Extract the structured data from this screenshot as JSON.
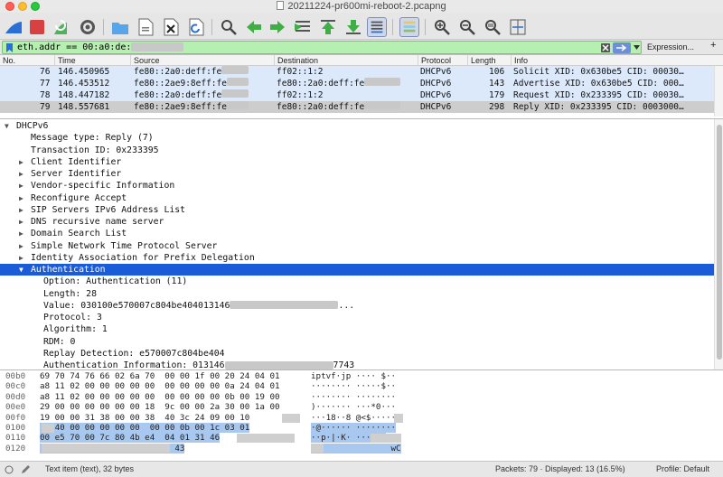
{
  "window": {
    "title": "20211224-pr600mi-reboot-2.pcapng"
  },
  "toolbar": {
    "icons": [
      "shark-fin-start-icon",
      "stop-icon",
      "restart-icon",
      "options-gear-icon",
      "open-folder-icon",
      "save-icon",
      "close-file-icon",
      "reload-icon",
      "find-icon",
      "back-icon",
      "forward-icon",
      "go-to-packet-icon",
      "first-packet-icon",
      "last-packet-icon",
      "autoscroll-icon",
      "colorize-icon",
      "zoom-in-icon",
      "zoom-out-icon",
      "normal-size-icon",
      "resize-columns-icon"
    ]
  },
  "filter": {
    "value": "eth.addr == 00:a0:de:",
    "expression_label": "Expression...",
    "plus_label": "+"
  },
  "packet_list": {
    "columns": [
      "No.",
      "Time",
      "Source",
      "Destination",
      "Protocol",
      "Length",
      "Info"
    ],
    "rows": [
      {
        "no": "76",
        "time": "146.450965",
        "source": "fe80::2a0:deff:fe",
        "destination": "ff02::1:2",
        "protocol": "DHCPv6",
        "length": "106",
        "info": "Solicit XID: 0x630be5 CID: 00030…"
      },
      {
        "no": "77",
        "time": "146.453512",
        "source": "fe80::2ae9:8eff:fe",
        "destination": "fe80::2a0:deff:fe",
        "protocol": "DHCPv6",
        "length": "143",
        "info": "Advertise XID: 0x630be5 CID: 000…"
      },
      {
        "no": "78",
        "time": "148.447182",
        "source": "fe80::2a0:deff:fe",
        "destination": "ff02::1:2",
        "protocol": "DHCPv6",
        "length": "179",
        "info": "Request XID: 0x233395 CID: 00030…"
      },
      {
        "no": "79",
        "time": "148.557681",
        "source": "fe80::2ae9:8eff:fe",
        "destination": "fe80::2a0:deff:fe",
        "protocol": "DHCPv6",
        "length": "298",
        "info": "Reply XID: 0x233395 CID: 0003000…"
      }
    ]
  },
  "details": {
    "rows": [
      {
        "text": "DHCPv6",
        "indent": 0,
        "tri": "▼"
      },
      {
        "text": "Message type: Reply (7)",
        "indent": 1,
        "tri": ""
      },
      {
        "text": "Transaction ID: 0x233395",
        "indent": 1,
        "tri": ""
      },
      {
        "text": "Client Identifier",
        "indent": 1,
        "tri": "▶"
      },
      {
        "text": "Server Identifier",
        "indent": 1,
        "tri": "▶"
      },
      {
        "text": "Vendor-specific Information",
        "indent": 1,
        "tri": "▶"
      },
      {
        "text": "Reconfigure Accept",
        "indent": 1,
        "tri": "▶"
      },
      {
        "text": "SIP Servers IPv6 Address List",
        "indent": 1,
        "tri": "▶"
      },
      {
        "text": "DNS recursive name server",
        "indent": 1,
        "tri": "▶"
      },
      {
        "text": "Domain Search List",
        "indent": 1,
        "tri": "▶"
      },
      {
        "text": "Simple Network Time Protocol Server",
        "indent": 1,
        "tri": "▶"
      },
      {
        "text": "Identity Association for Prefix Delegation",
        "indent": 1,
        "tri": "▶"
      },
      {
        "text": "Authentication",
        "indent": 1,
        "tri": "▼",
        "selected": true
      },
      {
        "text": "Option: Authentication (11)",
        "indent": 2,
        "tri": ""
      },
      {
        "text": "Length: 28",
        "indent": 2,
        "tri": ""
      },
      {
        "text": "Value: 030100e570007c804be404013146",
        "indent": 2,
        "tri": "",
        "tail": "..."
      },
      {
        "text": "Protocol: 3",
        "indent": 2,
        "tri": ""
      },
      {
        "text": "Algorithm: 1",
        "indent": 2,
        "tri": ""
      },
      {
        "text": "RDM: 0",
        "indent": 2,
        "tri": ""
      },
      {
        "text": "Replay Detection: e570007c804be404",
        "indent": 2,
        "tri": ""
      },
      {
        "text": "Authentication Information: 013146",
        "indent": 2,
        "tri": "",
        "tail": "7743"
      }
    ]
  },
  "hex": {
    "rows": [
      {
        "off": "00b0",
        "bytes": "69 70 74 76 66 02 6a 70  00 00 1f 00 20 24 04 01",
        "ascii": "iptvf·jp ···· $··"
      },
      {
        "off": "00c0",
        "bytes": "a8 11 02 00 00 00 00 00  00 00 00 00 0a 24 04 01",
        "ascii": "········ ·····$··"
      },
      {
        "off": "00d0",
        "bytes": "a8 11 02 00 00 00 00 00  00 00 00 00 0b 00 19 00",
        "ascii": "········ ········"
      },
      {
        "off": "00e0",
        "bytes": "29 00 00 00 00 00 00 18  9c 00 00 2a 30 00 1a 00",
        "ascii": ")······· ···*0···"
      },
      {
        "off": "00f0",
        "bytes": "19 00 00 31 38 00 00 38  40 3c 24 09 00 10",
        "ascii": "···18··8 @<$·····"
      },
      {
        "off": "0100",
        "bytes": "   40 00 00 00 00 00  00 00 0b 00 1c 03 01",
        "ascii": "·@······ ········"
      },
      {
        "off": "0110",
        "bytes": "00 e5 70 00 7c 80 4b e4  04 01 31 46",
        "ascii": "··p·|·K· ···1FS"
      },
      {
        "off": "0120",
        "bytes": "                        77 43",
        "ascii": "                wC"
      }
    ]
  },
  "status": {
    "left": "Text item (text), 32 bytes",
    "packets": "Packets: 79 · Displayed: 13 (16.5%)",
    "profile": "Profile: Default"
  }
}
